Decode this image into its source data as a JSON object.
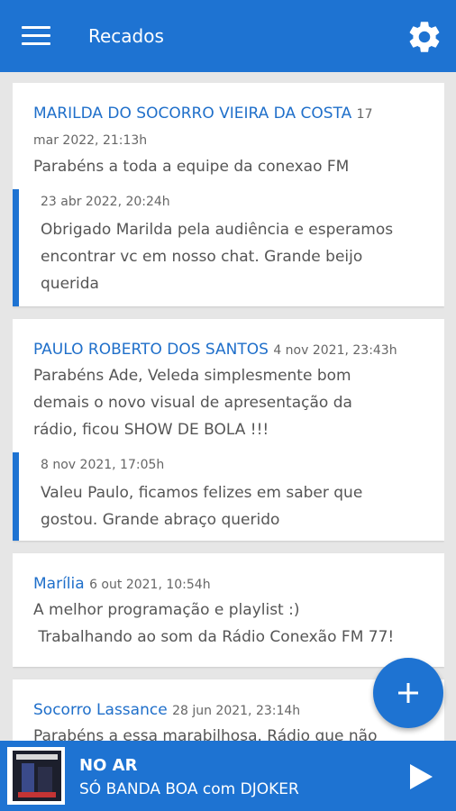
{
  "header": {
    "title": "Recados",
    "menu_icon": "menu-icon",
    "settings_icon": "gear-icon"
  },
  "messages": [
    {
      "author": "MARILDA DO SOCORRO VIEIRA DA COSTA",
      "time_part1": "17",
      "time_part2": "mar 2022, 21:13h",
      "text": "Parabéns a toda a equipe da conexao FM",
      "reply": {
        "time": "23 abr 2022, 20:24h",
        "line1": "Obrigado Marilda pela audiência e esperamos",
        "line2": "encontrar vc em nosso chat. Grande beijo",
        "line3": "querida"
      }
    },
    {
      "author": "PAULO ROBERTO DOS SANTOS",
      "time": "4 nov 2021, 23:43h",
      "line1": "Parabéns Ade, Veleda simplesmente bom",
      "line2": "demais o novo visual de apresentação da",
      "line3": "rádio, ficou SHOW DE BOLA  !!!",
      "reply": {
        "time": "8 nov 2021, 17:05h",
        "line1": "Valeu Paulo, ficamos felizes em saber que",
        "line2": "gostou. Grande abraço querido"
      }
    },
    {
      "author": "Marília",
      "time": "6 out 2021, 10:54h",
      "line1": "A melhor programação e playlist :)",
      "line2": " Trabalhando ao som da Rádio Conexão FM 77!"
    },
    {
      "author": "Socorro Lassance",
      "time": "28 jun 2021, 23:14h",
      "line1": "Parabéns a essa marabilhosa. Rádio que não"
    }
  ],
  "fab": {
    "icon": "plus-icon"
  },
  "player": {
    "status": "NO AR",
    "track": "SÓ BANDA BOA com DJOKER",
    "play_icon": "play-icon"
  },
  "colors": {
    "primary": "#1e73d2",
    "author": "#1f6fca",
    "background": "#e6e6e6"
  }
}
